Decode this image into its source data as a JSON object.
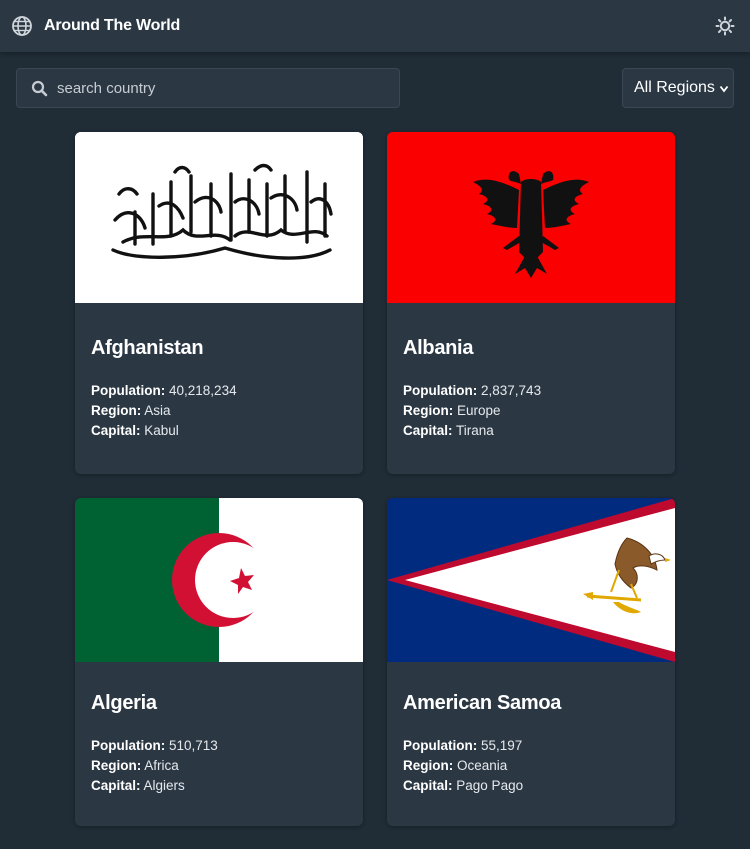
{
  "header": {
    "title": "Around The World",
    "icons": {
      "globe": "globe-icon",
      "theme": "sun-icon"
    }
  },
  "search": {
    "placeholder": "search country",
    "value": ""
  },
  "filter": {
    "selected": "All Regions"
  },
  "labels": {
    "population": "Population:",
    "region": "Region:",
    "capital": "Capital:"
  },
  "countries": [
    {
      "name": "Afghanistan",
      "population": "40,218,234",
      "region": "Asia",
      "capital": "Kabul",
      "flag": "afghanistan-flag"
    },
    {
      "name": "Albania",
      "population": "2,837,743",
      "region": "Europe",
      "capital": "Tirana",
      "flag": "albania-flag"
    },
    {
      "name": "Algeria",
      "population": "510,713",
      "region": "Africa",
      "capital": "Algiers",
      "flag": "algeria-flag"
    },
    {
      "name": "American Samoa",
      "population": "55,197",
      "region": "Oceania",
      "capital": "Pago Pago",
      "flag": "american-samoa-flag"
    }
  ],
  "colors": {
    "background": "#202c36",
    "surface": "#2b3844",
    "text": "#ffffff"
  }
}
